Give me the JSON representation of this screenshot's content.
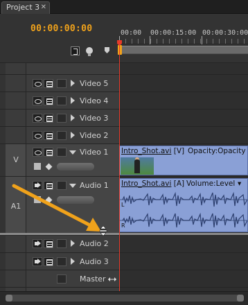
{
  "tab": {
    "label": "Project 3",
    "close": "✕"
  },
  "timecode": "00:00:00:00",
  "ruler": {
    "labels": [
      "00:00",
      "00:00:15:00",
      "00:00:30:00"
    ]
  },
  "tracks": {
    "video5": {
      "name": "Video 5"
    },
    "video4": {
      "name": "Video 4"
    },
    "video3": {
      "name": "Video 3"
    },
    "video2": {
      "name": "Video 2"
    },
    "video1": {
      "name": "Video 1",
      "target": "V"
    },
    "audio1": {
      "name": "Audio 1",
      "target": "A1"
    },
    "audio2": {
      "name": "Audio 2"
    },
    "audio3": {
      "name": "Audio 3"
    },
    "master": {
      "name": "Master"
    }
  },
  "clips": {
    "video": {
      "file": "Intro_Shot.avi",
      "tag": "[V]",
      "property": "Opacity:Opacity",
      "menu": "▾"
    },
    "audio": {
      "file": "Intro_Shot.avi",
      "tag": "[A]",
      "property": "Volume:Level",
      "menu": "▾",
      "channel_left": "L",
      "channel_right": "R"
    }
  },
  "colors": {
    "accent": "#f0a21b",
    "playhead": "#e83a2a",
    "clip": "#8aa0d6"
  }
}
